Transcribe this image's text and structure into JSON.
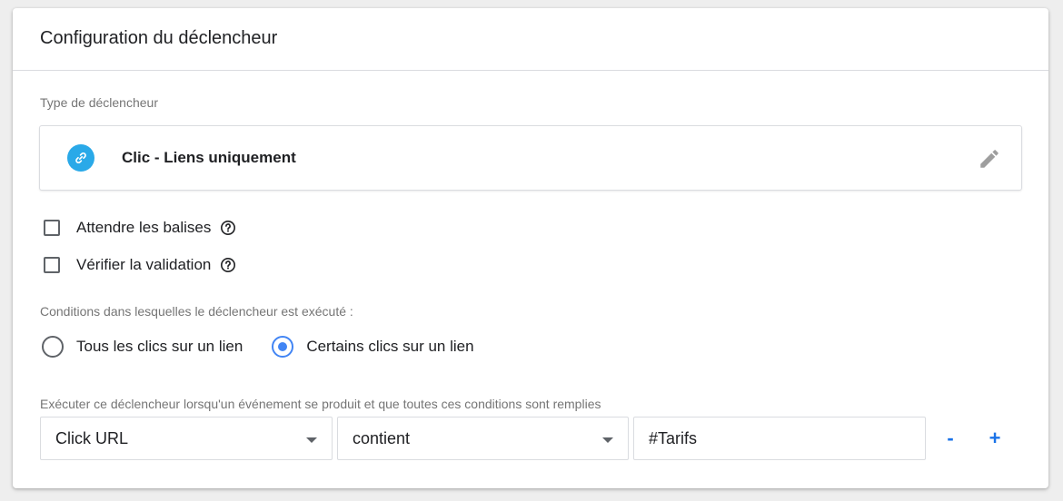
{
  "header": {
    "title": "Configuration du déclencheur"
  },
  "trigger_type": {
    "label": "Type de déclencheur",
    "name": "Clic - Liens uniquement",
    "icon": "link-icon",
    "icon_color": "#2aa9e8"
  },
  "options": {
    "wait_for_tags": {
      "label": "Attendre les balises",
      "checked": false
    },
    "check_validation": {
      "label": "Vérifier la validation",
      "checked": false
    }
  },
  "conditions": {
    "label": "Conditions dans lesquelles le déclencheur est exécuté :",
    "options": [
      {
        "label": "Tous les clics sur un lien",
        "selected": false
      },
      {
        "label": "Certains clics sur un lien",
        "selected": true
      }
    ]
  },
  "filter": {
    "label": "Exécuter ce déclencheur lorsqu'un événement se produit et que toutes ces conditions sont remplies",
    "variable": "Click URL",
    "operator": "contient",
    "value": "#Tarifs",
    "remove_label": "-",
    "add_label": "+"
  },
  "colors": {
    "accent": "#1a73e8",
    "radio_selected": "#4285f4",
    "label_gray": "#757575",
    "border": "#dadce0"
  }
}
